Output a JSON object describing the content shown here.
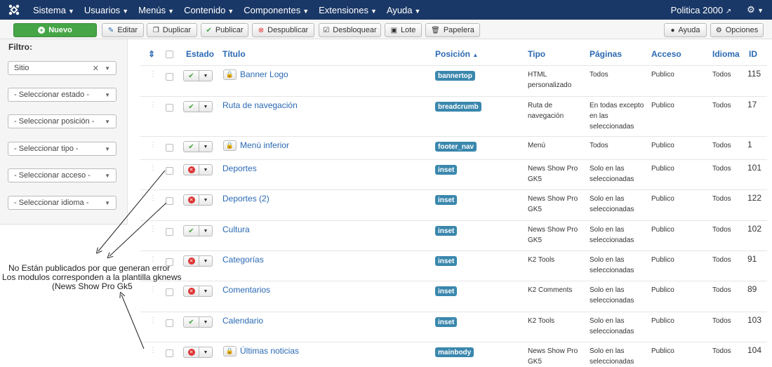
{
  "topbar": {
    "menus": [
      "Sistema",
      "Usuarios",
      "Menús",
      "Contenido",
      "Componentes",
      "Extensiones",
      "Ayuda"
    ],
    "site_name": "Politica 2000"
  },
  "toolbar": {
    "nuevo": "Nuevo",
    "editar": "Editar",
    "duplicar": "Duplicar",
    "publicar": "Publicar",
    "despublicar": "Despublicar",
    "desbloquear": "Desbloquear",
    "lote": "Lote",
    "papelera": "Papelera",
    "ayuda": "Ayuda",
    "opciones": "Opciones"
  },
  "sidebar": {
    "filter_label": "Filtro:",
    "site_select": "Sitio",
    "selects": [
      "- Seleccionar estado -",
      "- Seleccionar posición -",
      "- Seleccionar tipo -",
      "- Seleccionar acceso -",
      "- Seleccionar idioma -"
    ]
  },
  "table": {
    "headers": {
      "estado": "Estado",
      "titulo": "Título",
      "posicion": "Posición",
      "tipo": "Tipo",
      "paginas": "Páginas",
      "acceso": "Acceso",
      "idioma": "Idioma",
      "id": "ID"
    },
    "rows": [
      {
        "published": true,
        "locked": true,
        "title": "Banner Logo",
        "position": "bannertop",
        "tipo": [
          "HTML",
          "personalizado"
        ],
        "paginas": [
          "Todos"
        ],
        "acceso": "Publico",
        "idioma": "Todos",
        "id": "115"
      },
      {
        "published": true,
        "locked": false,
        "title": "Ruta de navegación",
        "position": "breadcrumb",
        "tipo": [
          "Ruta de",
          "navegación"
        ],
        "paginas": [
          "En todas excepto",
          "en las",
          "seleccionadas"
        ],
        "acceso": "Publico",
        "idioma": "Todos",
        "id": "17"
      },
      {
        "published": true,
        "locked": true,
        "title": "Menú inferior",
        "position": "footer_nav",
        "tipo": [
          "Menú"
        ],
        "paginas": [
          "Todos"
        ],
        "acceso": "Publico",
        "idioma": "Todos",
        "id": "1"
      },
      {
        "published": false,
        "locked": false,
        "title": "Deportes",
        "position": "inset",
        "tipo": [
          "News Show Pro",
          "GK5"
        ],
        "paginas": [
          "Solo en las",
          "seleccionadas"
        ],
        "acceso": "Publico",
        "idioma": "Todos",
        "id": "101"
      },
      {
        "published": false,
        "locked": false,
        "title": "Deportes (2)",
        "position": "inset",
        "tipo": [
          "News Show Pro",
          "GK5"
        ],
        "paginas": [
          "Solo en las",
          "seleccionadas"
        ],
        "acceso": "Publico",
        "idioma": "Todos",
        "id": "122"
      },
      {
        "published": true,
        "locked": false,
        "title": "Cultura",
        "position": "inset",
        "tipo": [
          "News Show Pro",
          "GK5"
        ],
        "paginas": [
          "Solo en las",
          "seleccionadas"
        ],
        "acceso": "Publico",
        "idioma": "Todos",
        "id": "102"
      },
      {
        "published": false,
        "locked": false,
        "title": "Categorías",
        "position": "inset",
        "tipo": [
          "K2 Tools"
        ],
        "paginas": [
          "Solo en las",
          "seleccionadas"
        ],
        "acceso": "Publico",
        "idioma": "Todos",
        "id": "91"
      },
      {
        "published": false,
        "locked": false,
        "title": "Comentarios",
        "position": "inset",
        "tipo": [
          "K2 Comments"
        ],
        "paginas": [
          "Solo en las",
          "seleccionadas"
        ],
        "acceso": "Publico",
        "idioma": "Todos",
        "id": "89"
      },
      {
        "published": true,
        "locked": false,
        "title": "Calendario",
        "position": "inset",
        "tipo": [
          "K2 Tools"
        ],
        "paginas": [
          "Solo en las",
          "seleccionadas"
        ],
        "acceso": "Publico",
        "idioma": "Todos",
        "id": "103"
      },
      {
        "published": false,
        "locked": true,
        "title": "Últimas noticias",
        "position": "mainbody",
        "tipo": [
          "News Show Pro",
          "GK5"
        ],
        "paginas": [
          "Solo en las",
          "seleccionadas"
        ],
        "acceso": "Publico",
        "idioma": "Todos",
        "id": "104"
      }
    ]
  },
  "annotation": {
    "line1": "No Están publicados por que generan error",
    "line2": "Los modulos corresponden a la plantilla gknews",
    "line3": "(News Show Pro Gk5"
  },
  "colors": {
    "navbar": "#1a3867",
    "link": "#2a69b3",
    "badge": "#3a87ad",
    "new_button": "#46a546",
    "unpublished": "#dd3333"
  }
}
